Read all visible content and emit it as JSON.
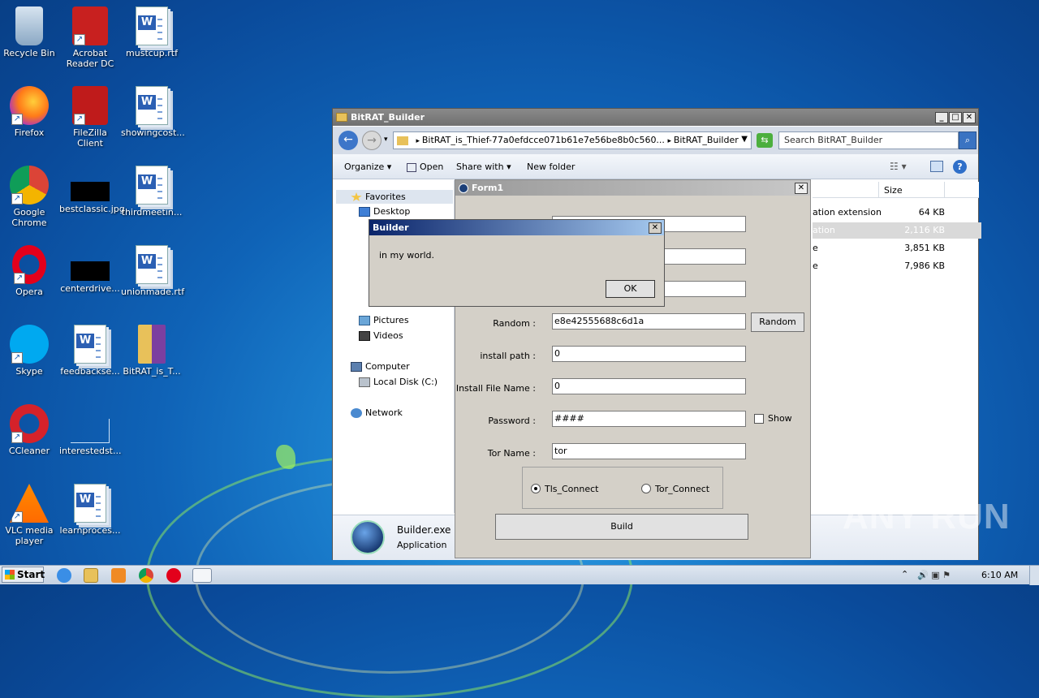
{
  "desktop": {
    "icons": [
      {
        "label": "Recycle Bin",
        "icon": "recycle-bin-icon"
      },
      {
        "label": "Acrobat Reader DC",
        "icon": "acrobat-icon"
      },
      {
        "label": "mustcup.rtf",
        "icon": "word-doc-icon"
      },
      {
        "label": "Firefox",
        "icon": "firefox-icon"
      },
      {
        "label": "FileZilla Client",
        "icon": "filezilla-icon"
      },
      {
        "label": "showingcost...",
        "icon": "word-doc-icon"
      },
      {
        "label": "Google Chrome",
        "icon": "chrome-icon"
      },
      {
        "label": "bestclassic.jpg",
        "icon": "image-thumb-icon"
      },
      {
        "label": "thirdmeetin...",
        "icon": "word-doc-icon"
      },
      {
        "label": "Opera",
        "icon": "opera-icon"
      },
      {
        "label": "centerdrive...",
        "icon": "image-thumb-icon"
      },
      {
        "label": "unionmade.rtf",
        "icon": "word-doc-icon"
      },
      {
        "label": "Skype",
        "icon": "skype-icon"
      },
      {
        "label": "feedbackse...",
        "icon": "word-doc-icon"
      },
      {
        "label": "BitRAT_is_T...",
        "icon": "archive-icon"
      },
      {
        "label": "CCleaner",
        "icon": "ccleaner-icon"
      },
      {
        "label": "interestedst...",
        "icon": "blank-file-icon"
      },
      {
        "label": "VLC media player",
        "icon": "vlc-icon"
      },
      {
        "label": "learnproces...",
        "icon": "word-doc-icon"
      }
    ]
  },
  "explorer": {
    "title": "BitRAT_Builder",
    "path_1": "BitRAT_is_Thief-77a0efdcce071b61e7e56be8b0c560...",
    "path_2": "BitRAT_Builder",
    "search_placeholder": "Search BitRAT_Builder",
    "toolbar": {
      "organize": "Organize",
      "open": "Open",
      "share_with": "Share with",
      "new_folder": "New folder"
    },
    "nav": {
      "favorites": "Favorites",
      "desktop": "Desktop",
      "pictures": "Pictures",
      "videos": "Videos",
      "computer": "Computer",
      "local_disk": "Local Disk (C:)",
      "network": "Network"
    },
    "columns": {
      "size": "Size"
    },
    "rows": [
      {
        "type": "ation extension",
        "size": "64 KB"
      },
      {
        "type": "ation",
        "size": "2,116 KB"
      },
      {
        "type": "e",
        "size": "3,851 KB"
      },
      {
        "type": "e",
        "size": "7,986 KB"
      }
    ],
    "details": {
      "name": "Builder.exe D",
      "kind": "Application"
    }
  },
  "form1": {
    "title": "Form1",
    "random_label": "Random :",
    "random_value": "e8e42555688c6d1a",
    "random_button": "Random",
    "install_path_label": "install path :",
    "install_path_value": "0",
    "install_file_label": "Install File Name :",
    "install_file_value": "0",
    "password_label": "Password :",
    "password_value": "####",
    "show_label": "Show",
    "tor_name_label": "Tor Name :",
    "tor_name_value": "tor",
    "tls_connect": "Tls_Connect",
    "tor_connect": "Tor_Connect",
    "build_button": "Build"
  },
  "dialog": {
    "title": "Builder",
    "message": "in my world.",
    "ok": "OK"
  },
  "taskbar": {
    "start": "Start",
    "time": "6:10 AM"
  },
  "watermark": "ANY RUN"
}
